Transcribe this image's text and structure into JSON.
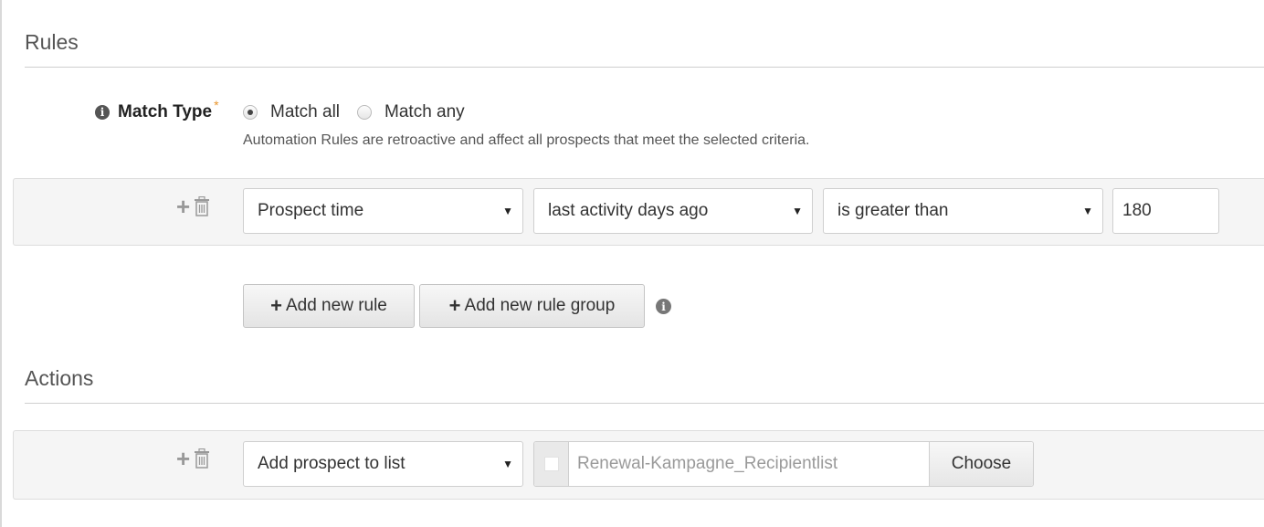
{
  "rules": {
    "title": "Rules",
    "match_type": {
      "label": "Match Type",
      "required_marker": "*",
      "options": [
        {
          "label": "Match all",
          "selected": true
        },
        {
          "label": "Match any",
          "selected": false
        }
      ],
      "help_text": "Automation Rules are retroactive and affect all prospects that meet the selected criteria."
    },
    "rule_row": {
      "field_select": "Prospect time",
      "attribute_select": "last activity days ago",
      "operator_select": "is greater than",
      "value": "180"
    },
    "add_rule_label": "Add new rule",
    "add_rule_group_label": "Add new rule group"
  },
  "actions": {
    "title": "Actions",
    "action_row": {
      "action_select": "Add prospect to list",
      "list_value": "Renewal-Kampagne_Recipientlist",
      "choose_label": "Choose"
    }
  },
  "icons": {
    "info": "info-icon",
    "add": "plus-icon",
    "delete": "trash-icon",
    "dropdown": "caret-down-icon"
  },
  "colors": {
    "required_star": "#e8942c",
    "row_background": "#f5f5f5"
  }
}
